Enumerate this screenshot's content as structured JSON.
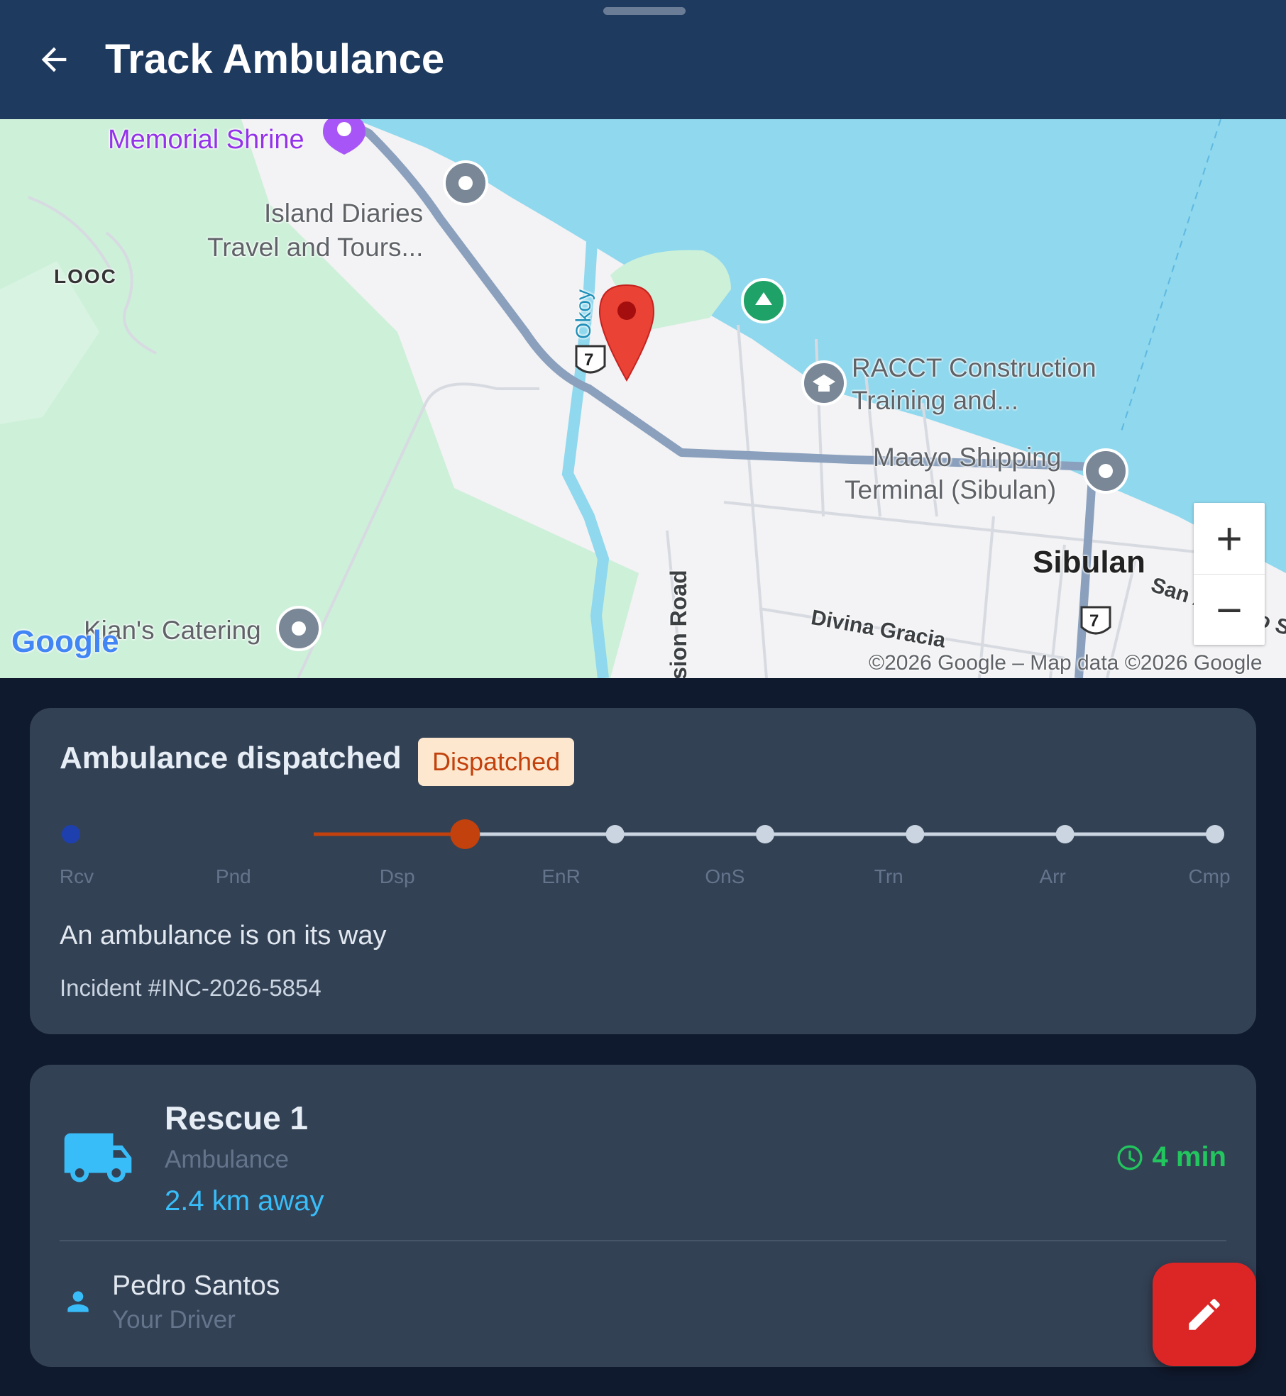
{
  "header": {
    "title": "Track Ambulance",
    "back_icon": "arrow-left-icon"
  },
  "map": {
    "labels": {
      "memorial": "Memorial Shrine",
      "island1": "Island Diaries",
      "island2": "Travel and Tours...",
      "looc": "LOOC",
      "okoy": "Okoy",
      "raccct1": "RACCT Construction",
      "raccct2": "Training and...",
      "maayo1": "Maayo Shipping",
      "maayo2": "Terminal (Sibulan)",
      "sibulan": "Sibulan",
      "sanantonio": "San Antonio St",
      "divina": "Divina Gracia",
      "missionroad": "sion Road",
      "kians": "Kian's Catering",
      "route7": "7",
      "route7b": "7",
      "google": "Google",
      "copyright": "©2026 Google – Map data ©2026 Google"
    },
    "zoom_in": "+",
    "zoom_out": "−",
    "colors": {
      "water": "#8fd8ee",
      "park": "#cdf0d9",
      "land": "#f3f2f4",
      "highway": "#8aa0bd",
      "marker": "#ea4335"
    }
  },
  "status_card": {
    "title": "Ambulance dispatched",
    "badge": "Dispatched",
    "steps": [
      "Rcv",
      "Pnd",
      "Dsp",
      "EnR",
      "OnS",
      "Trn",
      "Arr",
      "Cmp"
    ],
    "current_step": "Dsp",
    "message": "An ambulance is on its way",
    "incident": "Incident #INC-2026-5854",
    "colors": {
      "received": "#1e40af",
      "progress": "#c2410c",
      "current": "#c2410c",
      "pending": "#cbd5e1"
    }
  },
  "unit_card": {
    "name": "Rescue 1",
    "type": "Ambulance",
    "distance": "2.4 km away",
    "eta": "4 min",
    "driver_name": "Pedro Santos",
    "driver_role": "Your Driver",
    "icons": {
      "vehicle": "truck-icon",
      "eta": "clock-icon",
      "driver": "person-icon",
      "fab": "pencil-icon"
    }
  }
}
